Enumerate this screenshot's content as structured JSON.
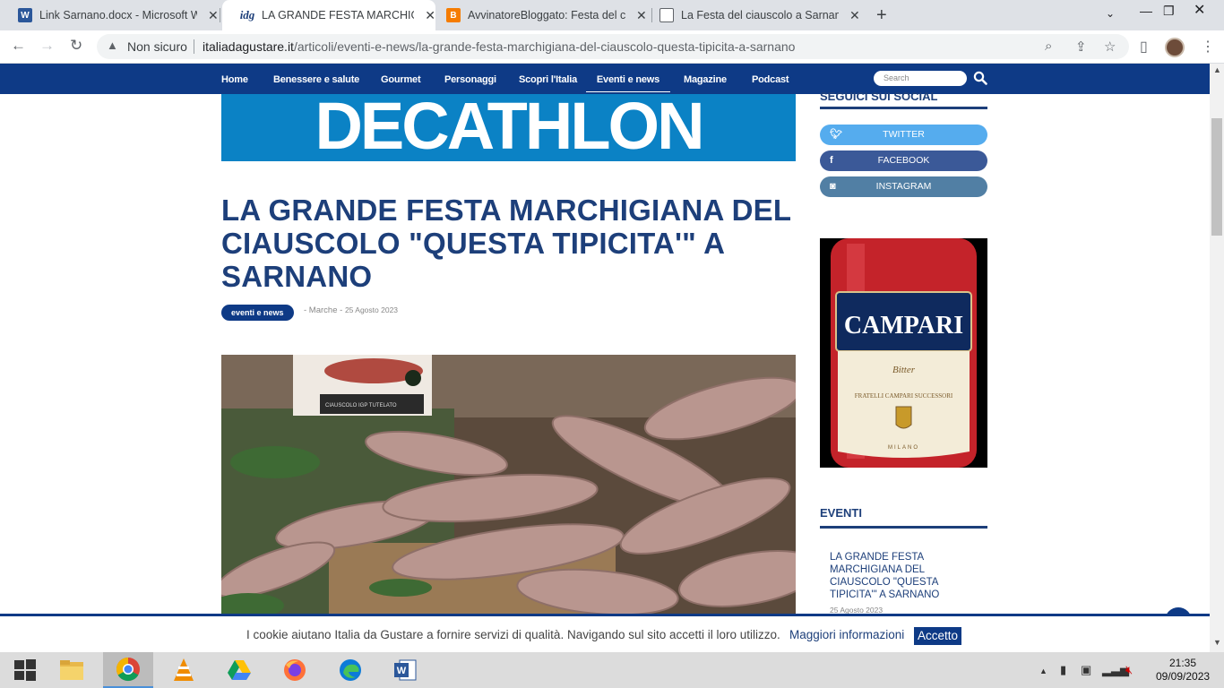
{
  "browser": {
    "tabs": [
      {
        "title": "Link Sarnano.docx - Microsoft Word Online",
        "icon": "word-icon",
        "color": "#2b579a"
      },
      {
        "title": "LA GRANDE FESTA MARCHIGIANA DEL CIAUSCOLO",
        "icon": "idg-icon",
        "color": "#1d3f7a"
      },
      {
        "title": "AvvinatoreBloggato: Festa del ciauscolo",
        "icon": "blogger-icon",
        "color": "#f57c00"
      },
      {
        "title": "La Festa del ciauscolo a Sarnano",
        "icon": "page-icon",
        "color": "#5f6368"
      }
    ],
    "security_label": "Non sicuro",
    "url_domain": "italiadagustare.it",
    "url_path": "/articoli/eventi-e-news/la-grande-festa-marchigiana-del-ciauscolo-questa-tipicita-a-sarnano"
  },
  "site": {
    "nav": [
      "Home",
      "Benessere e salute",
      "Gourmet",
      "Personaggi",
      "Scopri l'Italia",
      "Eventi e news",
      "Magazine",
      "Podcast"
    ],
    "active_nav": "Eventi e news",
    "search_placeholder": "Search",
    "brand_color": "#0e3a86"
  },
  "banner": {
    "text": "DECATHLON",
    "color": "#0b82c5"
  },
  "article": {
    "title": "LA GRANDE FESTA MARCHIGIANA DEL CIAUSCOLO \"QUESTA TIPICITA'\" A SARNANO",
    "tag": "eventi e news",
    "region": "- Marche -",
    "date": "25 Agosto 2023",
    "photo_label": "CIAUSCOLO IGP TUTELATO"
  },
  "sidebar": {
    "social_heading": "SEGUICI SUI SOCIAL",
    "social": [
      {
        "label": "TWITTER",
        "icon": "twitter-icon",
        "color": "#55acee"
      },
      {
        "label": "FACEBOOK",
        "icon": "facebook-icon",
        "color": "#3b5998"
      },
      {
        "label": "INSTAGRAM",
        "icon": "instagram-icon",
        "color": "#517fa4"
      }
    ],
    "ad": {
      "brand": "CAMPARI",
      "line": "FRATELLI CAMPARI SUCCESSORI",
      "city": "MILANO",
      "script": "Bitter"
    },
    "events_heading": "EVENTI",
    "events": [
      {
        "title": "LA GRANDE FESTA MARCHIGIANA DEL CIAUSCOLO \"QUESTA TIPICITA'\" A SARNANO",
        "date": "25 Agosto 2023"
      }
    ]
  },
  "cookie": {
    "message": "I cookie aiutano Italia da Gustare a fornire servizi di qualità. Navigando sul sito accetti il loro utilizzo.",
    "more": "Maggiori informazioni",
    "accept": "Accetto"
  },
  "taskbar": {
    "apps": [
      "start-icon",
      "file-explorer-icon",
      "chrome-icon",
      "vlc-icon",
      "google-drive-icon",
      "firefox-icon",
      "edge-icon",
      "word-icon"
    ],
    "time": "21:35",
    "date": "09/09/2023"
  }
}
